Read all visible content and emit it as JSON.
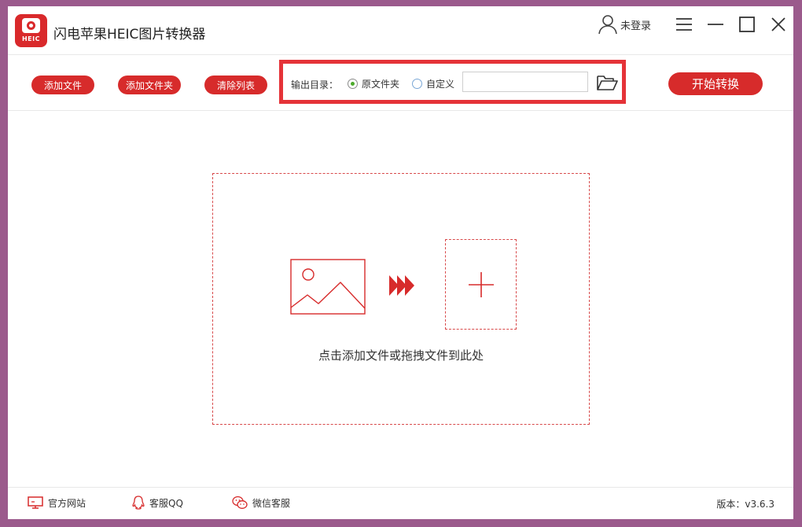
{
  "app": {
    "title": "闪电苹果HEIC图片转换器",
    "logo_text": "HEIC",
    "user_label": "未登录"
  },
  "colors": {
    "accent": "#d72b2b",
    "highlight_border": "#e53338",
    "radio_checked": "#4caa2b",
    "frame": "#9b5a8c"
  },
  "toolbar": {
    "add_file": "添加文件",
    "add_folder": "添加文件夹",
    "clear_list": "清除列表",
    "output": {
      "label": "输出目录：",
      "option_original": "原文件夹",
      "option_custom": "自定义",
      "selected": "原文件夹",
      "path_value": ""
    },
    "start": "开始转换"
  },
  "dropzone": {
    "hint": "点击添加文件或拖拽文件到此处",
    "icons": [
      "image-icon",
      "triple-arrow-icon",
      "plus-icon"
    ]
  },
  "footer": {
    "website": "官方网站",
    "qq": "客服QQ",
    "wechat": "微信客服",
    "version": "版本：v3.6.3"
  }
}
